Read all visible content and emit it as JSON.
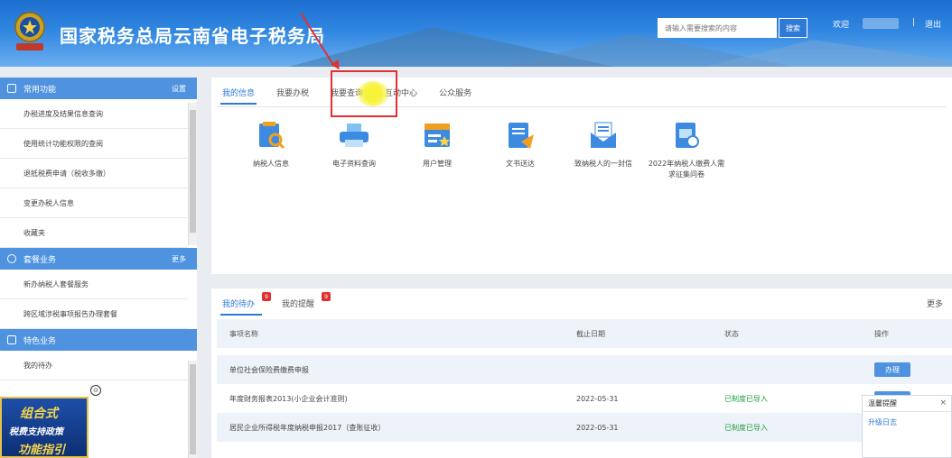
{
  "header": {
    "site_title": "国家税务总局云南省电子税务局",
    "emblem_text": "中国税务",
    "search_placeholder": "请输入需要搜索的内容",
    "search_button": "搜索",
    "welcome": "欢迎",
    "separator": "|",
    "logout": "退出"
  },
  "sidebar": {
    "sections": [
      {
        "title": "常用功能",
        "more": "设置",
        "icon": "bookmark-icon",
        "items": [
          "办税进度及结果信息查询",
          "使用统计功能权限的查阅",
          "退抵税费申请（税收多缴）",
          "变更办税人信息",
          "收藏夹"
        ]
      },
      {
        "title": "套餐业务",
        "more": "更多",
        "icon": "package-icon",
        "items": [
          "新办纳税人套餐服务",
          "跨区域涉税事项报告办理套餐"
        ]
      },
      {
        "title": "特色业务",
        "more": "",
        "icon": "grid-icon",
        "items": [
          "我的待办"
        ]
      }
    ]
  },
  "promo": {
    "line1": "组合式",
    "line2": "税费支持政策",
    "line3": "功能指引"
  },
  "my_info": {
    "tabs": [
      "我的信息",
      "我要办税",
      "我要查询",
      "互动中心",
      "公众服务"
    ],
    "active_tab": 0,
    "functions": [
      {
        "label": "纳税人信息",
        "icon": "taxpayer-info-icon"
      },
      {
        "label": "电子资料查询",
        "icon": "printer-icon"
      },
      {
        "label": "用户管理",
        "icon": "user-management-icon"
      },
      {
        "label": "文书送达",
        "icon": "document-delivery-icon"
      },
      {
        "label": "致纳税人的一封信",
        "icon": "letter-icon"
      },
      {
        "label": "2022年纳税人缴费人需求征集问卷",
        "icon": "survey-icon"
      }
    ]
  },
  "todo": {
    "tabs": [
      {
        "label": "我的待办",
        "badge": "9"
      },
      {
        "label": "我的提醒",
        "badge": "9"
      }
    ],
    "more": "更多",
    "columns": [
      "事项名称",
      "截止日期",
      "状态",
      "操作"
    ],
    "rows": [
      {
        "name": "单位社会保险费缴费申报",
        "deadline": "",
        "status": "",
        "action": "办理"
      },
      {
        "name": "年度财务报表2013(小企业会计准则)",
        "deadline": "2022-05-31",
        "status": "已制度已导入",
        "action": "办理"
      },
      {
        "name": "居民企业所得税年度纳税申报2017（查账征收）",
        "deadline": "2022-05-31",
        "status": "已制度已导入",
        "action": ""
      }
    ]
  },
  "popup": {
    "title": "温馨提醒",
    "link": "升级日志",
    "close": "×"
  },
  "colors": {
    "accent": "#2f7ad6",
    "sidebar_head": "#4e92e0",
    "highlight": "#e03030",
    "status_ok": "#1f9d3c"
  }
}
